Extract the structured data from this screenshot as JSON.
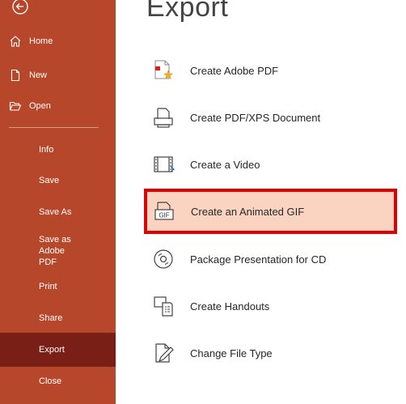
{
  "sidebar": {
    "back_label": "",
    "top_items": [
      {
        "label": "Home",
        "icon": "home-icon"
      },
      {
        "label": "New",
        "icon": "new-document-icon"
      },
      {
        "label": "Open",
        "icon": "folder-open-icon"
      }
    ],
    "sub_items": [
      {
        "label": "Info"
      },
      {
        "label": "Save"
      },
      {
        "label": "Save As"
      },
      {
        "label": "Save as Adobe PDF"
      },
      {
        "label": "Print"
      },
      {
        "label": "Share"
      },
      {
        "label": "Export",
        "active": true
      },
      {
        "label": "Close"
      }
    ],
    "bg_color": "#b7472a",
    "active_color": "#7a1f16"
  },
  "main": {
    "title": "Export",
    "options": [
      {
        "label": "Create Adobe PDF",
        "icon": "adobe-pdf-icon"
      },
      {
        "label": "Create PDF/XPS Document",
        "icon": "pdf-xps-document-icon"
      },
      {
        "label": "Create a Video",
        "icon": "video-icon"
      },
      {
        "label": "Create an Animated GIF",
        "icon": "gif-icon",
        "selected": true
      },
      {
        "label": "Package Presentation for CD",
        "icon": "cd-icon"
      },
      {
        "label": "Create Handouts",
        "icon": "handouts-icon"
      },
      {
        "label": "Change File Type",
        "icon": "change-file-type-icon"
      }
    ],
    "selected_bg": "#fbd4c1",
    "highlight_border": "#e00000"
  }
}
